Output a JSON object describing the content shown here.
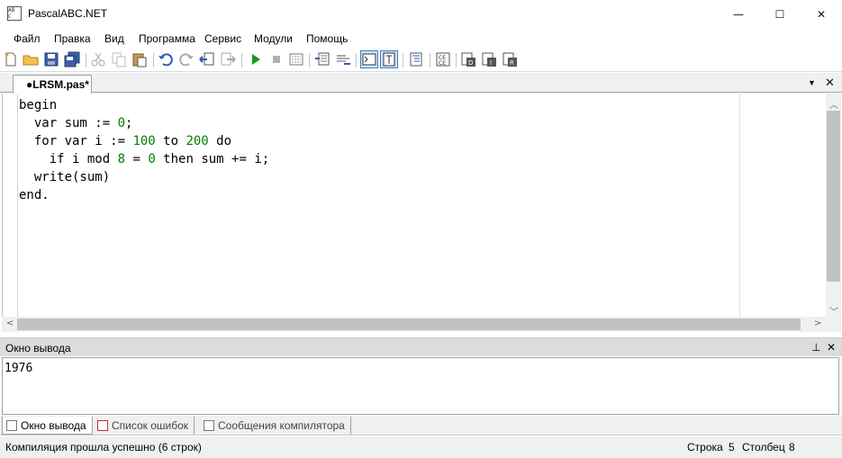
{
  "window": {
    "title": "PascalABC.NET",
    "app_icon_text": "AB C",
    "minimize_glyph": "—",
    "maximize_glyph": "☐",
    "close_glyph": "✕"
  },
  "menu": [
    "Файл",
    "Правка",
    "Вид",
    "Программа",
    "Сервис",
    "Модули",
    "Помощь"
  ],
  "toolbar_icons": [
    "new-file-icon",
    "open-folder-icon",
    "save-icon",
    "save-all-icon",
    "cut-icon",
    "copy-icon",
    "paste-icon",
    "undo-icon",
    "redo-icon",
    "navigate-back-icon",
    "navigate-forward-icon",
    "run-icon",
    "stop-icon",
    "compile-icon",
    "comment-icon",
    "uncomment-icon",
    "console-mode-icon",
    "text-mode-icon",
    "format-code-icon",
    "code-template-icon",
    "debug-icon",
    "step-into-icon",
    "step-over-icon"
  ],
  "editor_tab": {
    "label": "●LRSM.pas*",
    "dropdown_glyph": "▼",
    "close_glyph": "✕"
  },
  "code_lines": [
    "begin",
    "  var sum := 0;",
    "  for var i := 100 to 200 do",
    "    if i mod 8 = 0 then sum += i;",
    "  write(sum)",
    "end."
  ],
  "output_panel": {
    "title": "Окно вывода",
    "pin_glyph": "⊥",
    "close_glyph": "✕",
    "text": "1976"
  },
  "bottom_tabs": [
    "Окно вывода",
    "Список ошибок",
    "Сообщения компилятора"
  ],
  "status": {
    "message": "Компиляция прошла успешно (6 строк)",
    "row_label": "Строка",
    "row_value": "5",
    "col_label": "Столбец",
    "col_value": "8"
  },
  "colors": {
    "number_literal": "#008000",
    "run_green": "#1a9a1a"
  }
}
